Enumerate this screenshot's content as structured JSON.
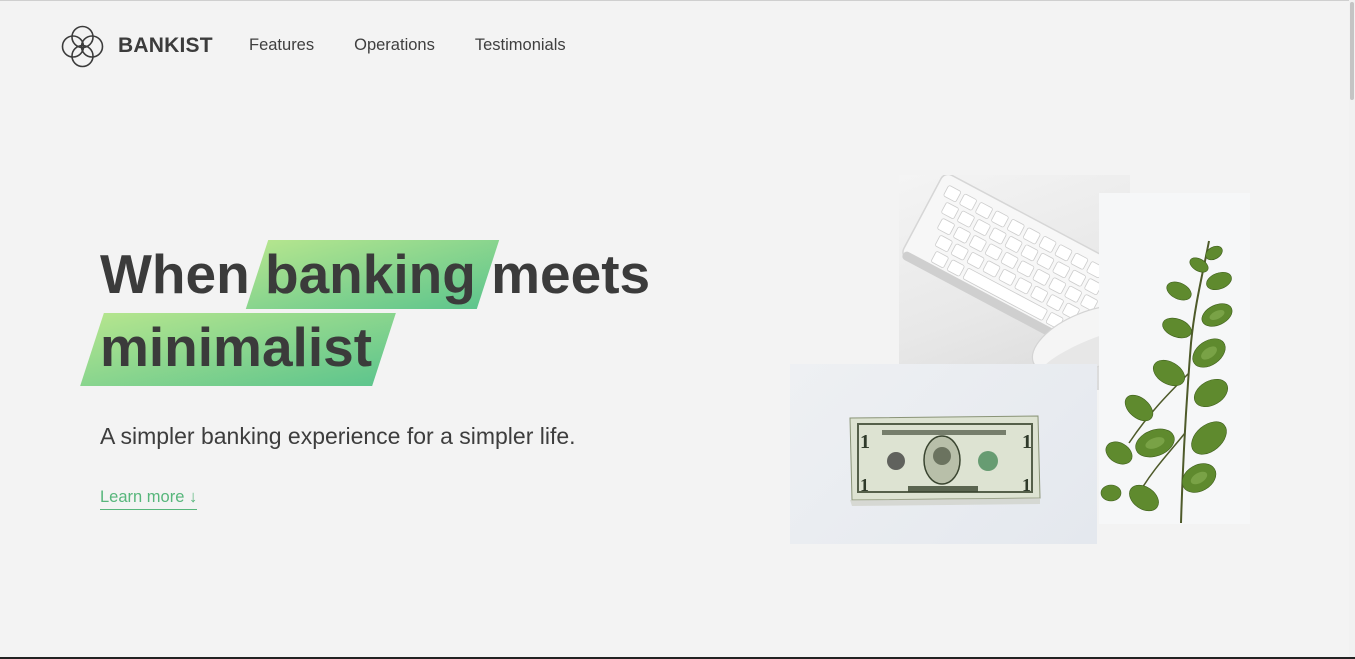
{
  "brand": {
    "name": "BANKIST",
    "logo_icon": "four-circles-logo-icon"
  },
  "nav": {
    "links": [
      {
        "label": "Features"
      },
      {
        "label": "Operations"
      },
      {
        "label": "Testimonials"
      }
    ]
  },
  "hero": {
    "title_part1": "When",
    "title_highlight1": "banking",
    "title_part2": "meets",
    "title_highlight2": "minimalist",
    "subtitle": "A simpler banking experience for a simpler life.",
    "cta_label": "Learn more ↓"
  },
  "images": {
    "keyboard": "keyboard-and-mouse-photo",
    "plant": "eucalyptus-plant-photo",
    "dollar": "one-dollar-bill-photo"
  },
  "colors": {
    "background": "#f3f3f3",
    "accent_green": "#57b67b",
    "highlight_start": "#b4e58e",
    "highlight_end": "#5ec58d",
    "text_dark": "#3b3b3b"
  }
}
